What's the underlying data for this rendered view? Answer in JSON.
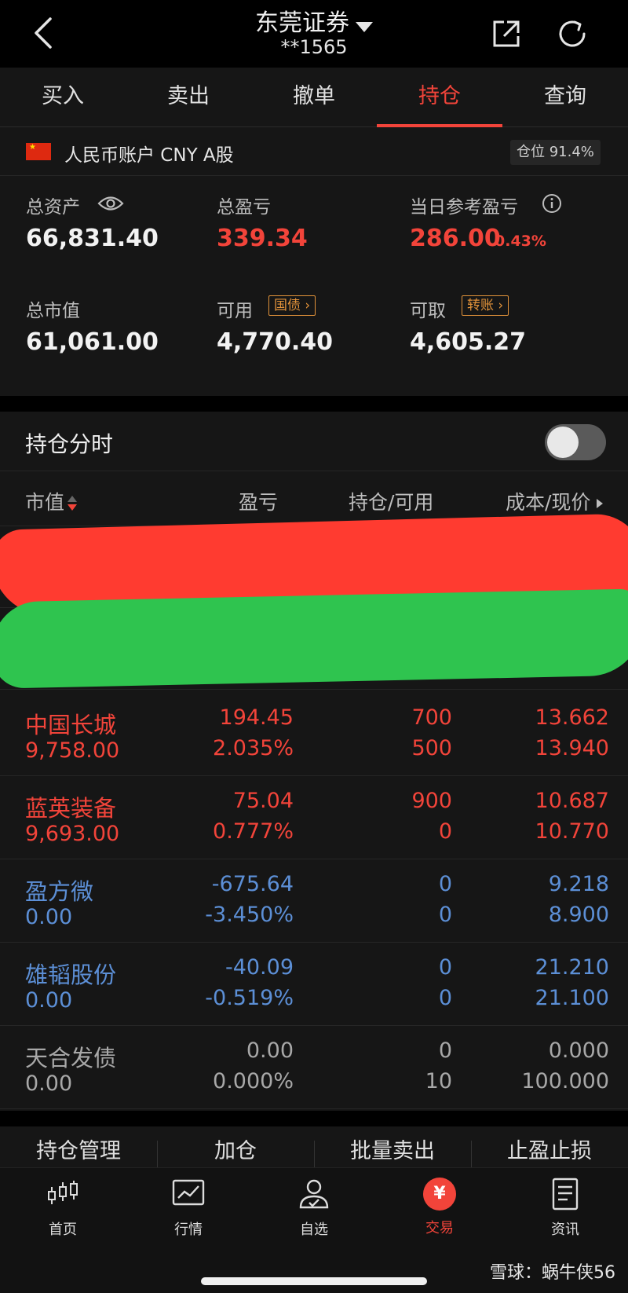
{
  "header": {
    "title": "东莞证券",
    "account_masked": "**1565"
  },
  "tabs": [
    {
      "label": "买入"
    },
    {
      "label": "卖出"
    },
    {
      "label": "撤单"
    },
    {
      "label": "持仓"
    },
    {
      "label": "查询"
    }
  ],
  "active_tab": "持仓",
  "account": {
    "label": "人民币账户 CNY A股",
    "position_ratio": "仓位 91.4%"
  },
  "summary": {
    "total_assets_label": "总资产",
    "total_assets": "66,831.40",
    "total_pnl_label": "总盈亏",
    "total_pnl": "339.34",
    "daily_pnl_label": "当日参考盈亏",
    "daily_pnl": "286.00",
    "daily_pnl_pct": "0.43%",
    "market_value_label": "总市值",
    "market_value": "61,061.00",
    "available_label": "可用",
    "available": "4,770.40",
    "available_tag": "国债",
    "withdrawable_label": "可取",
    "withdrawable": "4,605.27",
    "withdrawable_tag": "转账"
  },
  "chart_toggle": {
    "label": "持仓分时",
    "enabled": false
  },
  "table": {
    "headers": [
      "市值",
      "盈亏",
      "持仓/可用",
      "成本/现价"
    ],
    "rows": [
      {
        "name": "中国长城",
        "market_value": "9,758.00",
        "pnl": "194.45",
        "pnl_pct": "2.035%",
        "position": "700",
        "available": "500",
        "cost": "13.662",
        "price": "13.940",
        "trend": "up"
      },
      {
        "name": "蓝英装备",
        "market_value": "9,693.00",
        "pnl": "75.04",
        "pnl_pct": "0.777%",
        "position": "900",
        "available": "0",
        "cost": "10.687",
        "price": "10.770",
        "trend": "up"
      },
      {
        "name": "盈方微",
        "market_value": "0.00",
        "pnl": "-675.64",
        "pnl_pct": "-3.450%",
        "position": "0",
        "available": "0",
        "cost": "9.218",
        "price": "8.900",
        "trend": "down"
      },
      {
        "name": "雄韬股份",
        "market_value": "0.00",
        "pnl": "-40.09",
        "pnl_pct": "-0.519%",
        "position": "0",
        "available": "0",
        "cost": "21.210",
        "price": "21.100",
        "trend": "down"
      },
      {
        "name": "天合发债",
        "market_value": "0.00",
        "pnl": "0.00",
        "pnl_pct": "0.000%",
        "position": "0",
        "available": "10",
        "cost": "0.000",
        "price": "100.000",
        "trend": "flat"
      }
    ]
  },
  "actions": [
    "持仓管理",
    "加仓",
    "批量卖出",
    "止盈止损"
  ],
  "bottom_nav": [
    {
      "label": "首页",
      "icon": "candlestick-icon"
    },
    {
      "label": "行情",
      "icon": "chart-icon"
    },
    {
      "label": "自选",
      "icon": "user-check-icon"
    },
    {
      "label": "交易",
      "icon": "yuan-icon",
      "symbol": "¥"
    },
    {
      "label": "资讯",
      "icon": "document-icon"
    }
  ],
  "watermark": "雪球：蜗牛侠56",
  "colors": {
    "accent": "#f2443a",
    "down": "#5c8fd6",
    "tag": "#e1923a"
  }
}
